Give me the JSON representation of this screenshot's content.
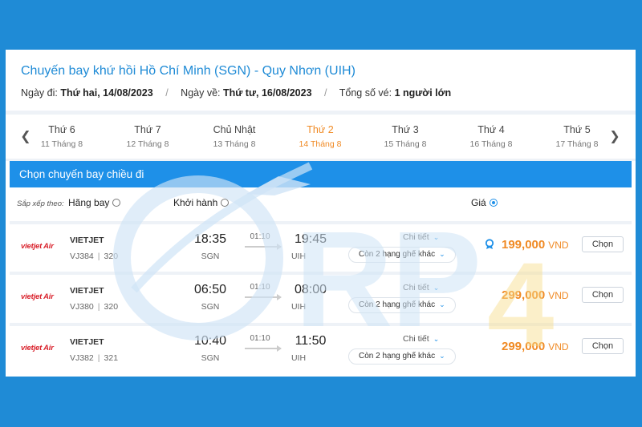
{
  "header": {
    "title": "Chuyến bay khứ hồi Hồ Chí Minh (SGN) - Quy Nhơn (UIH)",
    "depart_label": "Ngày đi:",
    "depart_value": "Thứ hai, 14/08/2023",
    "return_label": "Ngày về:",
    "return_value": "Thứ tư, 16/08/2023",
    "tickets_label": "Tổng số vé:",
    "tickets_value": "1 người lớn",
    "separator": "/"
  },
  "day_nav": {
    "prev_icon": "chevron-left-icon",
    "next_icon": "chevron-right-icon",
    "days": [
      {
        "name": "Thứ 6",
        "date": "11 Tháng 8"
      },
      {
        "name": "Thứ 7",
        "date": "12 Tháng 8"
      },
      {
        "name": "Chủ Nhật",
        "date": "13 Tháng 8"
      },
      {
        "name": "Thứ 2",
        "date": "14 Tháng 8"
      },
      {
        "name": "Thứ 3",
        "date": "15 Tháng 8"
      },
      {
        "name": "Thứ 4",
        "date": "16 Tháng 8"
      },
      {
        "name": "Thứ 5",
        "date": "17 Tháng 8"
      }
    ],
    "active_index": 3
  },
  "section": {
    "title": "Chọn chuyến bay chiều đi"
  },
  "sort": {
    "label": "Sắp xếp theo:",
    "airline": "Hãng bay",
    "departure": "Khởi hành",
    "price": "Giá",
    "selected": "price"
  },
  "flights": [
    {
      "logo": "vietjet Air",
      "airline": "VIETJET",
      "code": "VJ384",
      "aircraft": "320",
      "dep_time": "18:35",
      "dep_code": "SGN",
      "duration": "01:10",
      "arr_time": "19:45",
      "arr_code": "UIH",
      "detail": "Chi tiết",
      "seats": "Còn 2 hạng ghế khác",
      "price": "199,000",
      "currency": "VND",
      "best": true,
      "select": "Chọn"
    },
    {
      "logo": "vietjet Air",
      "airline": "VIETJET",
      "code": "VJ380",
      "aircraft": "320",
      "dep_time": "06:50",
      "dep_code": "SGN",
      "duration": "01:10",
      "arr_time": "08:00",
      "arr_code": "UIH",
      "detail": "Chi tiết",
      "seats": "Còn 2 hạng ghế khác",
      "price": "299,000",
      "currency": "VND",
      "best": false,
      "select": "Chọn"
    },
    {
      "logo": "vietjet Air",
      "airline": "VIETJET",
      "code": "VJ382",
      "aircraft": "321",
      "dep_time": "10:40",
      "dep_code": "SGN",
      "duration": "01:10",
      "arr_time": "11:50",
      "arr_code": "UIH",
      "detail": "Chi tiết",
      "seats": "Còn 2 hạng ghế khác",
      "price": "299,000",
      "currency": "VND",
      "best": false,
      "select": "Chọn"
    }
  ],
  "watermark": {
    "text": "RP4U"
  },
  "colors": {
    "background": "#1f8bd6",
    "accent": "#1e90e8",
    "price": "#f08a24",
    "logo": "#d9232d"
  }
}
